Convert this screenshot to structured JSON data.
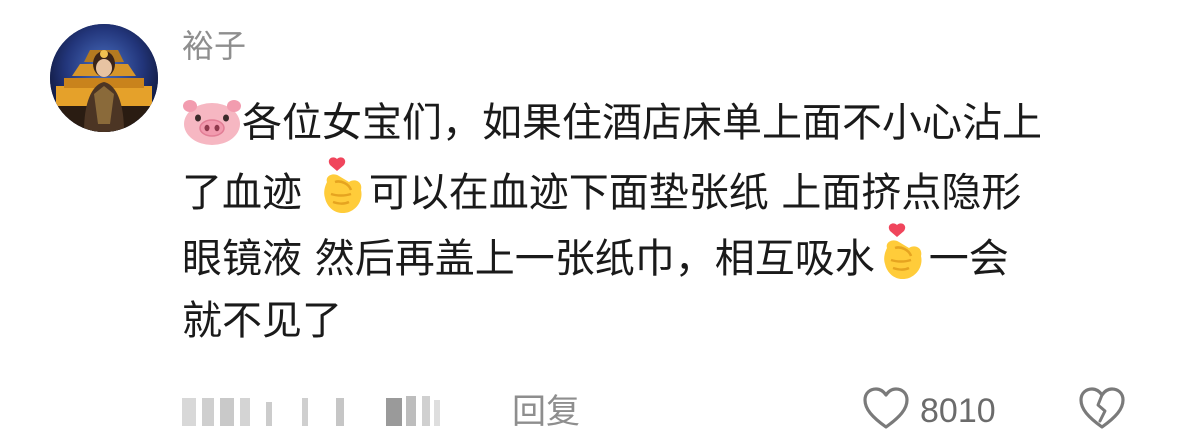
{
  "comment": {
    "username": "裕子",
    "lines": [
      {
        "pre": "",
        "text": "各位女宝们，如果住酒店床单上面不小心沾上",
        "post": ""
      },
      {
        "pre": "了血迹 ",
        "text": "",
        "post": "可以在血迹下面垫张纸 上面挤点隐形"
      },
      {
        "pre": "眼镜液  然后再盖上一张纸巾，相互吸水",
        "text": "",
        "post": "一会"
      },
      {
        "pre": "就不见了",
        "text": "",
        "post": ""
      }
    ],
    "emojis": {
      "lead": "pig-face-icon",
      "heart_hand": "finger-heart-icon"
    },
    "footer": {
      "reply_label": "回复",
      "like_count": "8010"
    }
  },
  "colors": {
    "text": "#1a1a1a",
    "muted": "#8e8e8e",
    "icon": "#7a7a7a"
  }
}
